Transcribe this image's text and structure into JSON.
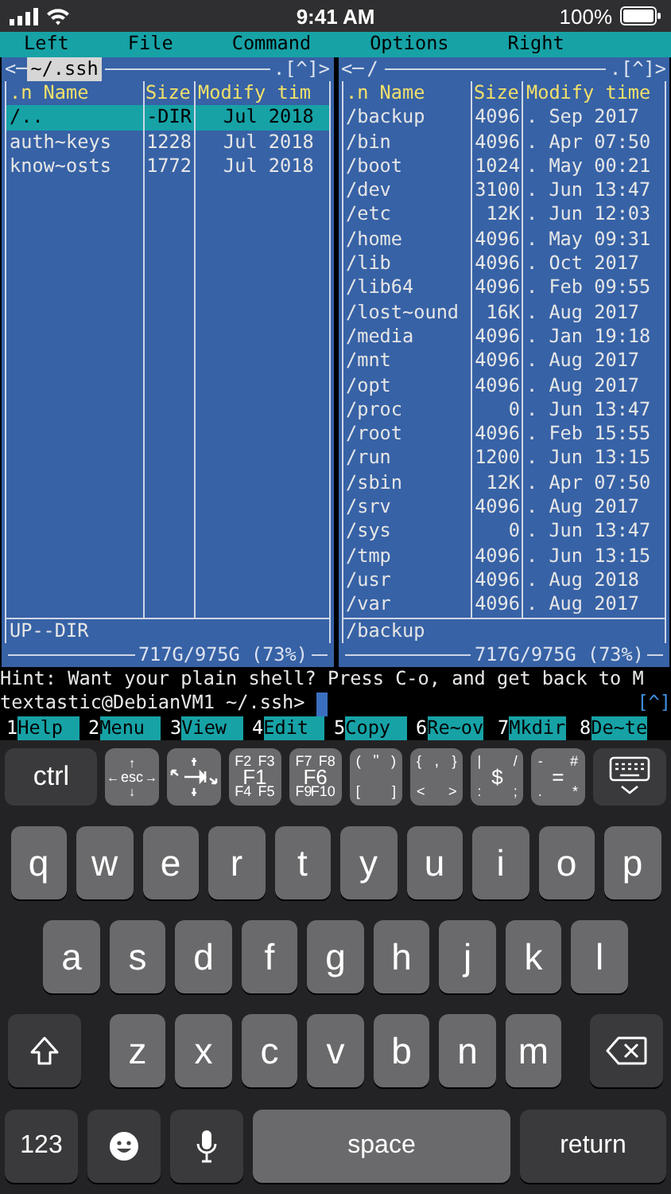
{
  "status_bar": {
    "time": "9:41 AM",
    "battery": "100%"
  },
  "menu": [
    "Left",
    "File",
    "Command",
    "Options",
    "Right"
  ],
  "panels": [
    {
      "nav_left": "<─",
      "path": "~/.ssh",
      "active": true,
      "nav_right": ".[^]>",
      "columns": [
        ".n Name",
        "Size",
        "Modify tim"
      ],
      "rows": [
        {
          "name": "/..",
          "size": "-DIR",
          "time": "Jul 2018",
          "selected": true
        },
        {
          "name": "auth~keys",
          "size": "1228",
          "time": "Jul 2018",
          "selected": false
        },
        {
          "name": "know~osts",
          "size": "1772",
          "time": "Jul 2018",
          "selected": false
        }
      ],
      "mini_status": "UP--DIR",
      "disk": "717G/975G (73%)"
    },
    {
      "nav_left": "<─",
      "path": "/",
      "active": false,
      "nav_right": ".[^]>",
      "columns": [
        ".n Name",
        "Size",
        "Modify time"
      ],
      "rows": [
        {
          "name": "/backup",
          "size": "4096",
          "time": ". Sep 2017",
          "selected": false
        },
        {
          "name": "/bin",
          "size": "4096",
          "time": ". Apr 07:50",
          "selected": false
        },
        {
          "name": "/boot",
          "size": "1024",
          "time": ". May 00:21",
          "selected": false
        },
        {
          "name": "/dev",
          "size": "3100",
          "time": ". Jun 13:47",
          "selected": false
        },
        {
          "name": "/etc",
          "size": "12K",
          "time": ". Jun 12:03",
          "selected": false
        },
        {
          "name": "/home",
          "size": "4096",
          "time": ". May 09:31",
          "selected": false
        },
        {
          "name": "/lib",
          "size": "4096",
          "time": ". Oct 2017",
          "selected": false
        },
        {
          "name": "/lib64",
          "size": "4096",
          "time": ". Feb 09:55",
          "selected": false
        },
        {
          "name": "/lost~ound",
          "size": "16K",
          "time": ". Aug 2017",
          "selected": false
        },
        {
          "name": "/media",
          "size": "4096",
          "time": ". Jan 19:18",
          "selected": false
        },
        {
          "name": "/mnt",
          "size": "4096",
          "time": ". Aug 2017",
          "selected": false
        },
        {
          "name": "/opt",
          "size": "4096",
          "time": ". Aug 2017",
          "selected": false
        },
        {
          "name": "/proc",
          "size": "0",
          "time": ". Jun 13:47",
          "selected": false
        },
        {
          "name": "/root",
          "size": "4096",
          "time": ". Feb 15:55",
          "selected": false
        },
        {
          "name": "/run",
          "size": "1200",
          "time": ". Jun 13:15",
          "selected": false
        },
        {
          "name": "/sbin",
          "size": "12K",
          "time": ". Apr 07:50",
          "selected": false
        },
        {
          "name": "/srv",
          "size": "4096",
          "time": ". Aug 2017",
          "selected": false
        },
        {
          "name": "/sys",
          "size": "0",
          "time": ". Jun 13:47",
          "selected": false
        },
        {
          "name": "/tmp",
          "size": "4096",
          "time": ". Jun 13:15",
          "selected": false
        },
        {
          "name": "/usr",
          "size": "4096",
          "time": ". Aug 2018",
          "selected": false
        },
        {
          "name": "/var",
          "size": "4096",
          "time": ". Aug 2017",
          "selected": false
        }
      ],
      "mini_status": "/backup",
      "disk": "717G/975G (73%)"
    }
  ],
  "hint": "Hint: Want your plain shell? Press C-o, and get back to M",
  "prompt": "textastic@DebianVM1 ~/.ssh>",
  "prompt_indicator": "[^]",
  "function_keys": [
    {
      "num": "1",
      "label": "Help"
    },
    {
      "num": "2",
      "label": "Menu"
    },
    {
      "num": "3",
      "label": "View"
    },
    {
      "num": "4",
      "label": "Edit"
    },
    {
      "num": "5",
      "label": "Copy"
    },
    {
      "num": "6",
      "label": "Re~ov"
    },
    {
      "num": "7",
      "label": "Mkdir"
    },
    {
      "num": "8",
      "label": "De~te"
    }
  ],
  "accessory_keys": [
    {
      "kind": "text",
      "label": "ctrl"
    },
    {
      "kind": "cross",
      "top": "↑",
      "left": "←",
      "center": "esc",
      "right": "→",
      "bottom": "↓"
    },
    {
      "kind": "icon"
    },
    {
      "kind": "grid",
      "top_left": "F2",
      "top_right": "F3",
      "center": "F1",
      "bottom_left": "F4",
      "bottom_right": "F5"
    },
    {
      "kind": "grid",
      "top_left": "F7",
      "top_right": "F8",
      "center": "F6",
      "bottom_left": "F9",
      "bottom_right": "F10"
    },
    {
      "kind": "grid",
      "top_left": "(",
      "top": "\"",
      "top_right": ")",
      "bottom_left": "[",
      "bottom_right": "]"
    },
    {
      "kind": "grid",
      "top_left": "{",
      "top": ",",
      "top_right": "}",
      "bottom_left": "<",
      "bottom_right": ">"
    },
    {
      "kind": "grid",
      "top_left": "|",
      "center": "$",
      "top_right": "/",
      "bottom_left": ":",
      "bottom_right": ";"
    },
    {
      "kind": "grid",
      "top_left": "-",
      "center": "=",
      "top_right": "#",
      "bottom_left": ".",
      "bottom_right": "*"
    },
    {
      "kind": "dismiss"
    }
  ],
  "keyboard_rows": [
    [
      "q",
      "w",
      "e",
      "r",
      "t",
      "y",
      "u",
      "i",
      "o",
      "p"
    ],
    [
      "a",
      "s",
      "d",
      "f",
      "g",
      "h",
      "j",
      "k",
      "l"
    ],
    [
      "z",
      "x",
      "c",
      "v",
      "b",
      "n",
      "m"
    ]
  ],
  "bottom_keys": {
    "numbers": "123",
    "space": "space",
    "return": "return"
  }
}
